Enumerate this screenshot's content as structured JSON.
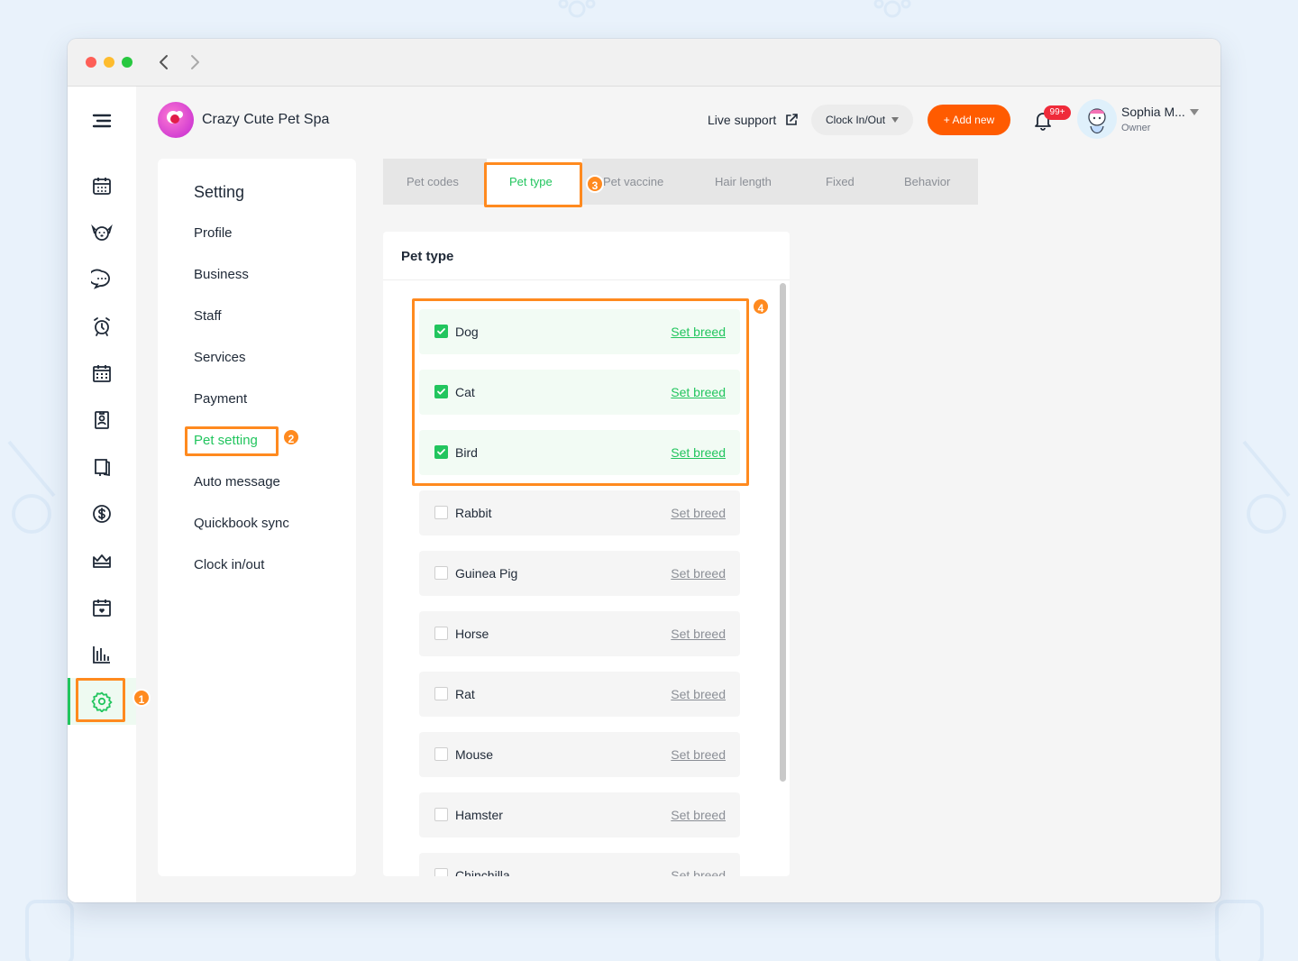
{
  "brand": {
    "name": "Crazy Cute Pet Spa"
  },
  "header": {
    "live_support": "Live support",
    "clock_button": "Clock In/Out",
    "add_button": "+ Add new",
    "notification_count": "99+",
    "user_name": "Sophia M...",
    "user_role": "Owner"
  },
  "settings": {
    "title": "Setting",
    "items": [
      {
        "label": "Profile"
      },
      {
        "label": "Business"
      },
      {
        "label": "Staff"
      },
      {
        "label": "Services"
      },
      {
        "label": "Payment"
      },
      {
        "label": "Pet setting"
      },
      {
        "label": "Auto message"
      },
      {
        "label": "Quickbook sync"
      },
      {
        "label": "Clock in/out"
      }
    ]
  },
  "tabs": [
    {
      "label": "Pet codes"
    },
    {
      "label": "Pet type"
    },
    {
      "label": "Pet vaccine"
    },
    {
      "label": "Hair length"
    },
    {
      "label": "Fixed"
    },
    {
      "label": "Behavior"
    }
  ],
  "panel": {
    "title": "Pet type",
    "rows": [
      {
        "label": "Dog",
        "link": "Set breed",
        "checked": true
      },
      {
        "label": "Cat",
        "link": "Set breed",
        "checked": true
      },
      {
        "label": "Bird",
        "link": "Set breed",
        "checked": true
      },
      {
        "label": "Rabbit",
        "link": "Set breed",
        "checked": false
      },
      {
        "label": "Guinea Pig",
        "link": "Set breed",
        "checked": false
      },
      {
        "label": "Horse",
        "link": "Set breed",
        "checked": false
      },
      {
        "label": "Rat",
        "link": "Set breed",
        "checked": false
      },
      {
        "label": "Mouse",
        "link": "Set breed",
        "checked": false
      },
      {
        "label": "Hamster",
        "link": "Set breed",
        "checked": false
      },
      {
        "label": "Chinchilla",
        "link": "Set breed",
        "checked": false
      }
    ]
  },
  "annotations": [
    "1",
    "2",
    "3",
    "4"
  ],
  "colors": {
    "accent": "#22c55e",
    "primary_button": "#ff5b00",
    "annotation": "#ff8a1f"
  }
}
